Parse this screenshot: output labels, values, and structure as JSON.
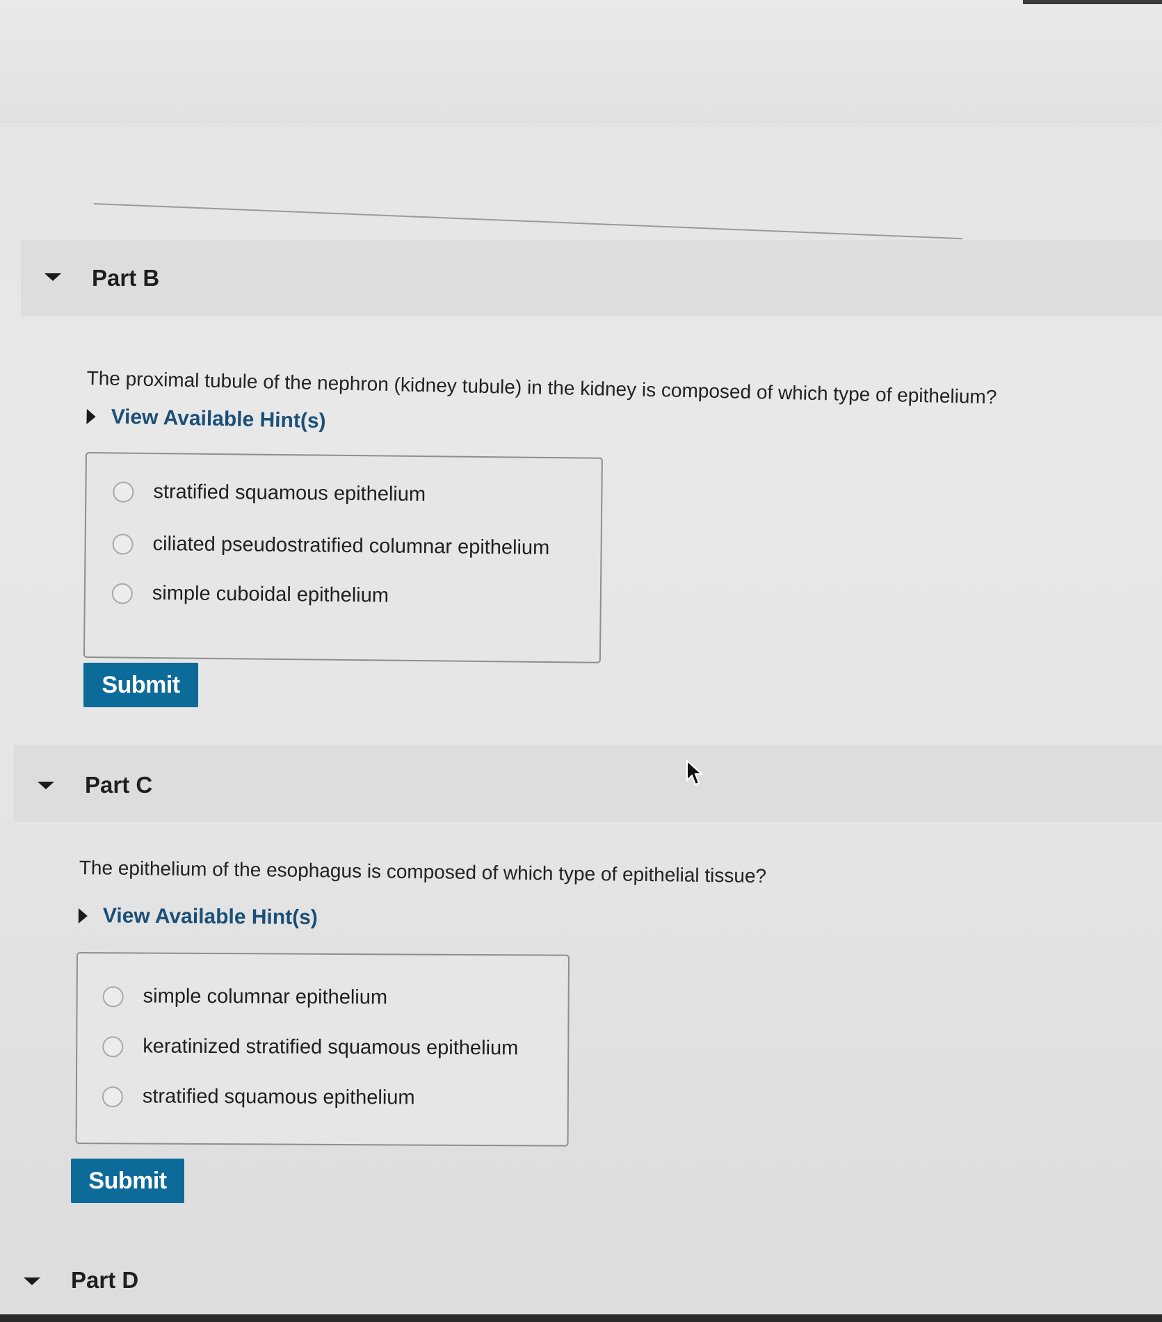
{
  "parts": [
    {
      "title": "Part B",
      "question": "The proximal tubule of the nephron (kidney tubule) in the kidney is composed of which type of epithelium?",
      "hint_label": "View Available Hint(s)",
      "options": [
        "stratified squamous epithelium",
        "ciliated pseudostratified columnar epithelium",
        "simple cuboidal epithelium"
      ],
      "submit_label": "Submit"
    },
    {
      "title": "Part C",
      "question": "The epithelium of the esophagus is composed of which type of epithelial tissue?",
      "hint_label": "View Available Hint(s)",
      "options": [
        "simple columnar epithelium",
        "keratinized stratified squamous epithelium",
        "stratified squamous epithelium"
      ],
      "submit_label": "Submit"
    },
    {
      "title": "Part D"
    }
  ],
  "colors": {
    "accent": "#0d6b99",
    "hint_link": "#1b4f78"
  }
}
